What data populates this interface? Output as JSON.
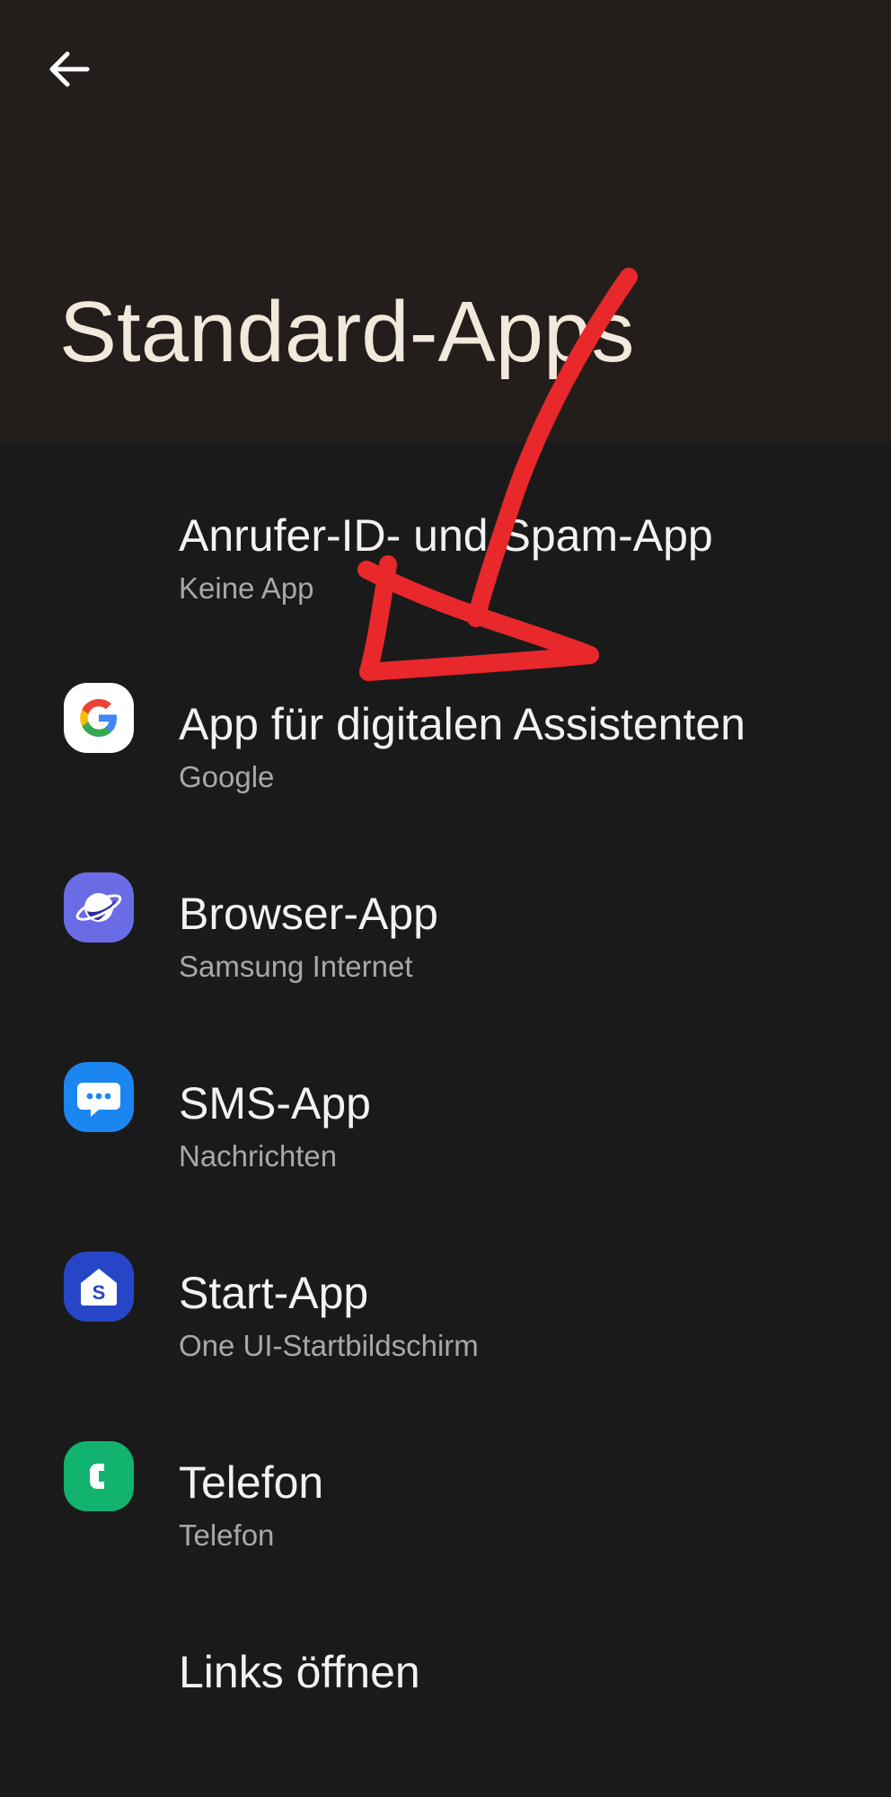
{
  "header": {
    "title": "Standard-Apps"
  },
  "items": [
    {
      "title": "Anrufer-ID- und Spam-App",
      "subtitle": "Keine App",
      "icon": "none"
    },
    {
      "title": "App für digitalen Assistenten",
      "subtitle": "Google",
      "icon": "google-icon"
    },
    {
      "title": "Browser-App",
      "subtitle": "Samsung Internet",
      "icon": "samsung-internet-icon"
    },
    {
      "title": "SMS-App",
      "subtitle": "Nachrichten",
      "icon": "messages-icon"
    },
    {
      "title": "Start-App",
      "subtitle": "One UI-Startbildschirm",
      "icon": "one-ui-home-icon"
    },
    {
      "title": "Telefon",
      "subtitle": "Telefon",
      "icon": "phone-icon"
    },
    {
      "title": "Links öffnen",
      "subtitle": "",
      "icon": "none"
    }
  ],
  "colors": {
    "header_bg": "#231e1c",
    "list_bg": "#1a1a1a",
    "title_text": "#f3e8dc",
    "annotation_red": "#e8282b"
  }
}
